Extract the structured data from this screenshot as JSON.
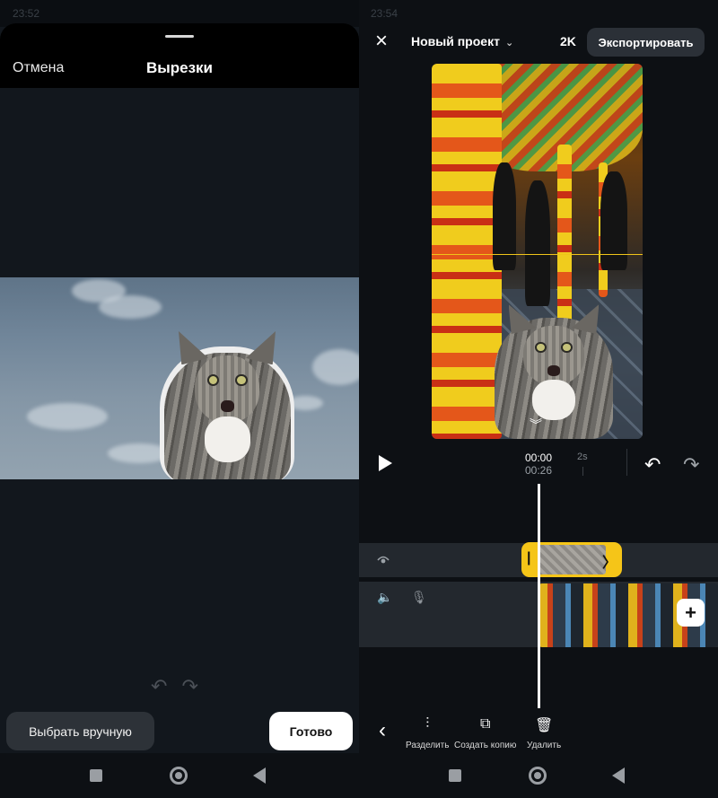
{
  "left": {
    "status_time": "23:52",
    "cancel_label": "Отмена",
    "title": "Вырезки",
    "undo_icon": "undo-icon",
    "redo_icon": "redo-icon",
    "manual_button": "Выбрать вручную",
    "done_button": "Готово"
  },
  "right": {
    "status_time": "23:54",
    "close_icon": "×",
    "project_name": "Новый проект",
    "resolution": "2K",
    "export_button": "Экспортировать",
    "current_time": "00:00",
    "total_time": "00:26",
    "tick_label": "2s",
    "tools": [
      {
        "name": "split",
        "label": "Разделить",
        "icon": "split-icon"
      },
      {
        "name": "duplicate",
        "label": "Создать копию",
        "icon": "copy-icon"
      },
      {
        "name": "delete",
        "label": "Удалить",
        "icon": "trash-icon"
      }
    ]
  },
  "navbar": {
    "icons": [
      "recents-icon",
      "home-icon",
      "back-icon"
    ]
  },
  "colors": {
    "accent_yellow": "#f5c518",
    "background": "#0d1014",
    "panel": "#23282e",
    "button_dark": "#2d3238"
  }
}
